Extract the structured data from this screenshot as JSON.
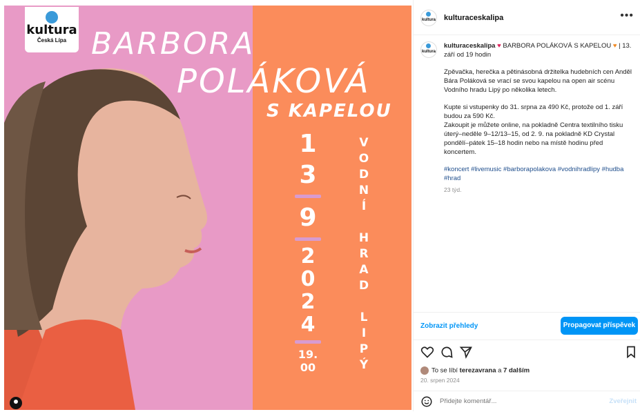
{
  "poster": {
    "logo_title": "kultura",
    "logo_subtitle": "Česká Lípa",
    "title_line1": "BARBORA",
    "title_line2": "POLÁKOVÁ",
    "title_line3": "S KAPELOU",
    "date_day": [
      "1",
      "3"
    ],
    "date_month": "9",
    "date_year": [
      "2",
      "0",
      "2",
      "4"
    ],
    "date_time": [
      "19.",
      "00"
    ],
    "venue_words": [
      "V",
      "O",
      "D",
      "N",
      "Í",
      " ",
      "H",
      "R",
      "A",
      "D",
      " ",
      "L",
      "I",
      "P",
      "Ý"
    ],
    "colors": {
      "pink": "#e89ac6",
      "orange": "#fb8c5b"
    }
  },
  "post": {
    "account": "kulturaceskalipa",
    "caption_user": "kulturaceskalipa",
    "caption_title": "BARBORA POLÁKOVÁ S KAPELOU",
    "caption_date": "| 13. září od 19 hodin",
    "paragraph1": "Zpěvačka, herečka a pětinásobná držitelka hudebních cen Anděl Bára Poláková se vrací se svou kapelou na open air scénu Vodního hradu Lipý po několika letech.",
    "paragraph2a": "Kupte si vstupenky do 31. srpna za 490 Kč, protože od 1. září budou za 590 Kč.",
    "paragraph2b": "Zakoupit je můžete online, na pokladně Centra textilního tisku úterý–neděle 9–12/13–15, od 2. 9. na pokladně KD Crystal pondělí–pátek 15–18 hodin nebo na místě hodinu před koncertem.",
    "hashtags": "#koncert #livemusic #barborapolakova #vodnihradlipy #hudba #hrad",
    "time_ago": "23 týd.",
    "insights_label": "Zobrazit přehledy",
    "promote_label": "Propagovat příspěvek",
    "likes_prefix": "To se líbí ",
    "likes_user": "terezavrana",
    "likes_middle": " a ",
    "likes_others": "7 dalším",
    "post_date": "20. srpen 2024",
    "comment_placeholder": "Přidejte komentář...",
    "post_button": "Zveřejnit"
  }
}
